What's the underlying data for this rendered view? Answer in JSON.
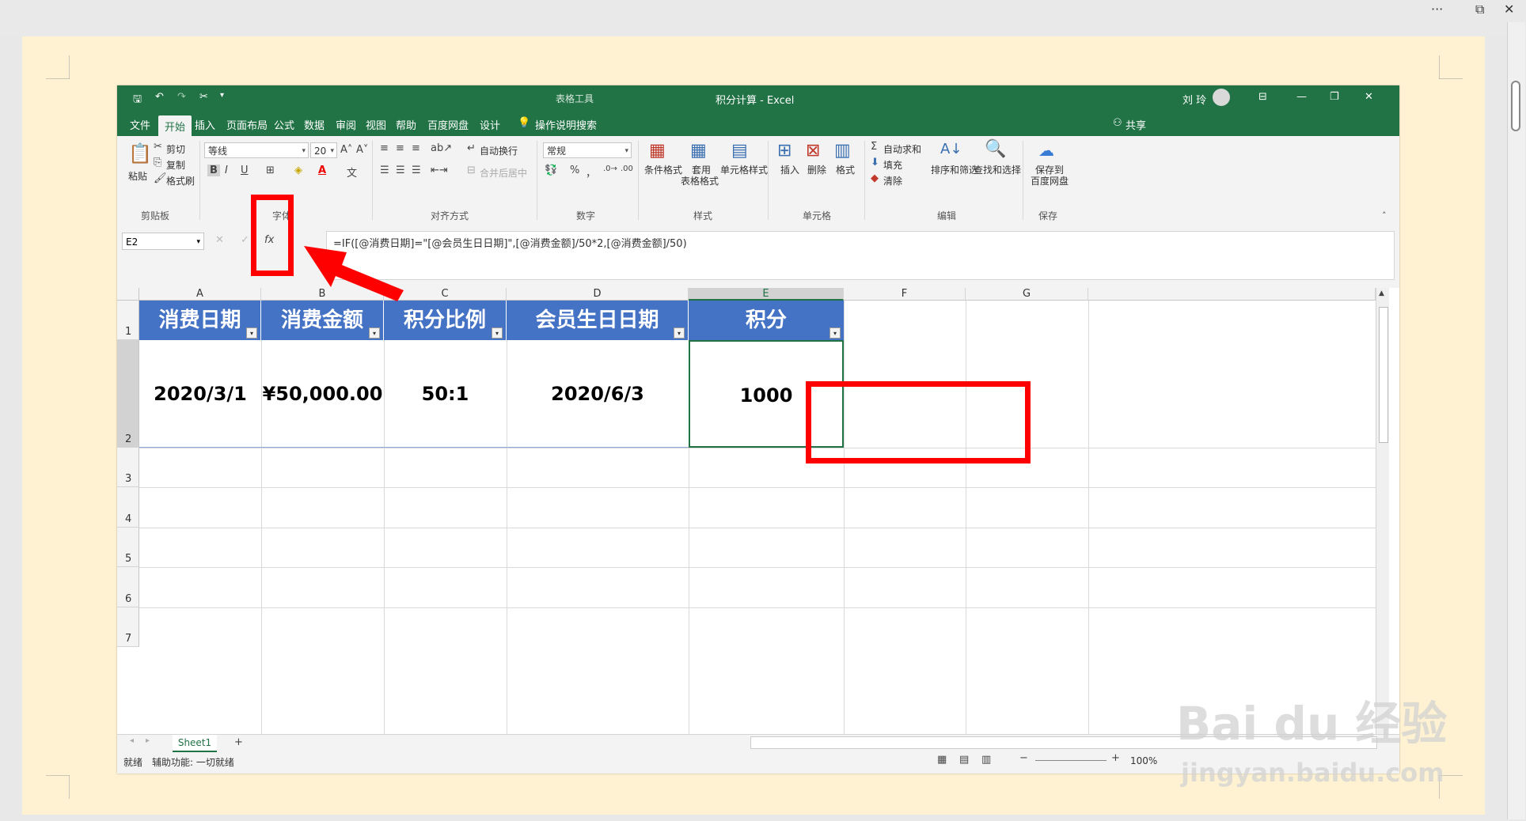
{
  "outer": {
    "more_label": "···",
    "restore_label": "⧉",
    "close_label": "✕"
  },
  "excel": {
    "title": "积分计算  -  Excel",
    "context_tools": "表格工具",
    "user": "刘 玲",
    "tabs": [
      "文件",
      "开始",
      "插入",
      "页面布局",
      "公式",
      "数据",
      "审阅",
      "视图",
      "帮助",
      "百度网盘",
      "设计"
    ],
    "tell_me": "操作说明搜索",
    "share": "共享"
  },
  "ribbon": {
    "clipboard": {
      "paste": "粘贴",
      "cut": "剪切",
      "copy": "复制",
      "format_painter": "格式刷",
      "label": "剪贴板"
    },
    "font": {
      "name": "等线",
      "size": "20",
      "label": "字体",
      "bold": "B",
      "italic": "I",
      "underline": "U"
    },
    "alignment": {
      "wrap": "自动换行",
      "merge": "合并后居中",
      "label": "对齐方式"
    },
    "number": {
      "format": "常规",
      "percent": "%",
      "comma": "，",
      "label": "数字"
    },
    "styles": {
      "conditional": "条件格式",
      "table_format_1": "套用",
      "table_format_2": "表格格式",
      "cell_styles": "单元格样式",
      "label": "样式"
    },
    "cells": {
      "insert": "插入",
      "delete": "删除",
      "format": "格式",
      "label": "单元格"
    },
    "editing": {
      "autosum": "自动求和",
      "fill": "填充",
      "clear": "清除",
      "sort_filter": "排序和筛选",
      "find_select": "查找和选择",
      "label": "编辑"
    },
    "save": {
      "line1": "保存到",
      "line2": "百度网盘",
      "label": "保存"
    }
  },
  "formula_bar": {
    "name_box": "E2",
    "cancel": "✕",
    "enter": "✓",
    "fx": "fx",
    "formula": "=IF([@消费日期]=\"[@会员生日日期]\",[@消费金额]/50*2,[@消费金额]/50)"
  },
  "sheet": {
    "columns": [
      "A",
      "B",
      "C",
      "D",
      "E",
      "F",
      "G"
    ],
    "rows": [
      "1",
      "2",
      "3",
      "4",
      "5",
      "6",
      "7"
    ],
    "headers": [
      "消费日期",
      "消费金额",
      "积分比例",
      "会员生日日期",
      "积分"
    ],
    "row2": [
      "2020/3/1",
      "¥50,000.00",
      "50:1",
      "2020/6/3",
      "1000"
    ],
    "filter_glyph": "▾"
  },
  "tabs": {
    "sheet1": "Sheet1",
    "add": "+"
  },
  "status": {
    "ready": "就绪",
    "accessibility": "辅助功能: 一切就绪",
    "zoom": "100%"
  },
  "watermark": {
    "logo": "Bai du 经验",
    "url": "jingyan.baidu.com"
  },
  "annotation_color": "#ff0000",
  "theme_color": "#217346",
  "header_fill": "#4472c4"
}
